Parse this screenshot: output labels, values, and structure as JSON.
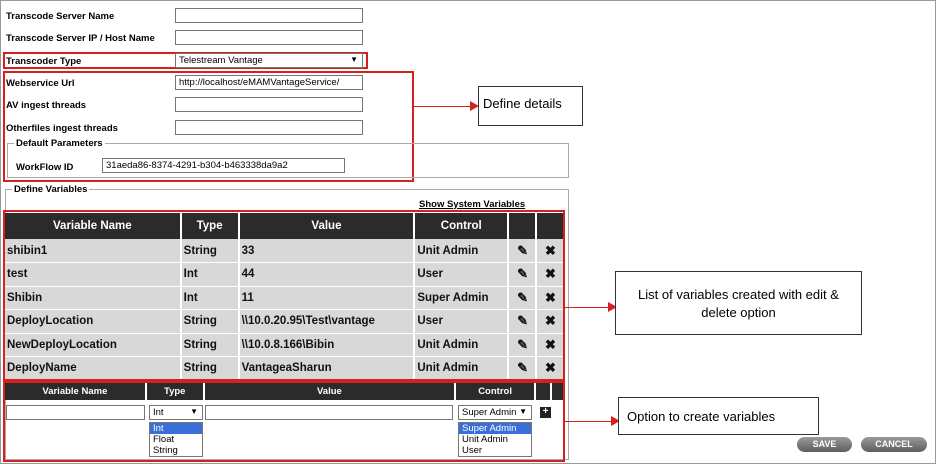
{
  "form": {
    "transcode_server_name_label": "Transcode Server Name",
    "transcode_server_ip_label": "Transcode Server IP / Host Name",
    "transcoder_type_label": "Transcoder Type",
    "transcoder_type_value": "Telestream Vantage",
    "webservice_url_label": "Webservice Url",
    "webservice_url_value": "http://localhost/eMAMVantageService/",
    "av_ingest_label": "AV ingest threads",
    "other_ingest_label": "Otherfiles ingest threads",
    "default_params_legend": "Default Parameters",
    "workflow_id_label": "WorkFlow ID",
    "workflow_id_value": "31aeda86-8374-4291-b304-b463338da9a2",
    "define_variables_legend": "Define Variables",
    "show_system_variables": "Show System Variables"
  },
  "variables_table": {
    "headers": [
      "Variable Name",
      "Type",
      "Value",
      "Control"
    ],
    "rows": [
      [
        "shibin1",
        "String",
        "33",
        "Unit Admin"
      ],
      [
        "test",
        "Int",
        "44",
        "User"
      ],
      [
        "Shibin",
        "Int",
        "11",
        "Super Admin"
      ],
      [
        "DeployLocation",
        "String",
        "\\\\10.0.20.95\\Test\\vantage",
        "User"
      ],
      [
        "NewDeployLocation",
        "String",
        "\\\\10.0.8.166\\Bibin",
        "Unit Admin"
      ],
      [
        "DeployName",
        "String",
        "VantageaSharun",
        "Unit Admin"
      ]
    ]
  },
  "new_variable": {
    "headers": [
      "Variable Name",
      "Type",
      "Value",
      "Control"
    ],
    "type_selected": "Int",
    "type_options": [
      "Int",
      "Float",
      "String"
    ],
    "control_selected": "Super Admin",
    "control_options": [
      "Super Admin",
      "Unit Admin",
      "User"
    ]
  },
  "annotations": {
    "define_details": "Define details",
    "list_of_variables": "List of variables created with edit & delete option",
    "option_to_create": "Option to create variables"
  },
  "buttons": {
    "save": "SAVE",
    "cancel": "CANCEL"
  },
  "colors": {
    "highlight_red": "#d62020",
    "header_dark": "#2b2b2b",
    "row_grey": "#d8d8d8"
  }
}
